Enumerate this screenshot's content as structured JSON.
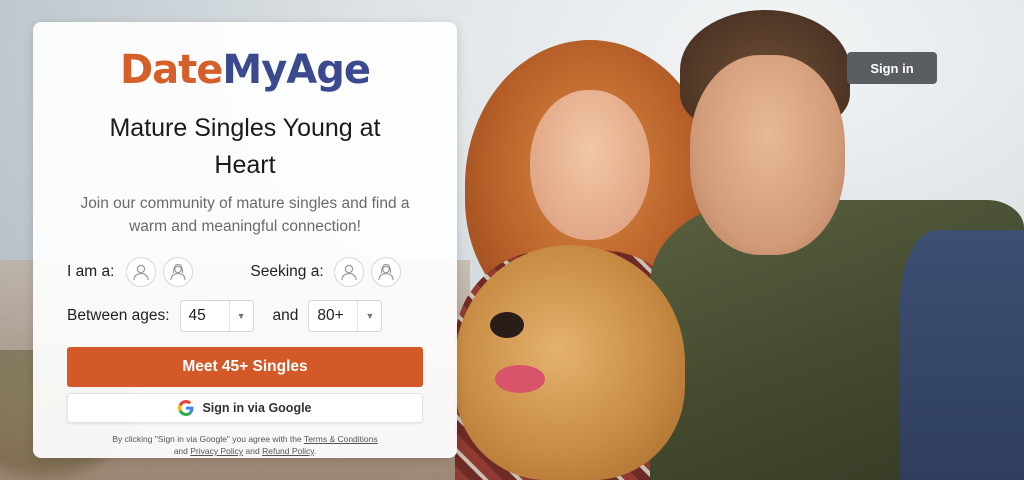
{
  "brand": {
    "logo_part1": "Date",
    "logo_part2": "MyAge",
    "color_primary": "#d55f2a",
    "color_secondary": "#3b4a8f"
  },
  "header": {
    "signin_label": "Sign in"
  },
  "hero": {
    "headline": "Mature Singles Young at Heart",
    "subtext": "Join our community of mature singles and find a warm and meaningful connection!"
  },
  "form": {
    "iam_label": "I am a:",
    "seeking_label": "Seeking a:",
    "ages_label": "Between ages:",
    "and_label": "and",
    "age_min": "45",
    "age_max": "80+",
    "avatars": {
      "male_icon": "male-avatar-icon",
      "female_icon": "female-avatar-icon"
    }
  },
  "actions": {
    "primary_label": "Meet 45+ Singles",
    "google_label": "Sign in via Google",
    "primary_color": "#d35a28"
  },
  "legal": {
    "prefix": "By clicking \"Sign in via Google\" you agree with the",
    "terms": "Terms & Conditions",
    "and1": "and",
    "privacy": "Privacy Policy",
    "and2": "and",
    "refund": "Refund Policy",
    "suffix": "."
  }
}
